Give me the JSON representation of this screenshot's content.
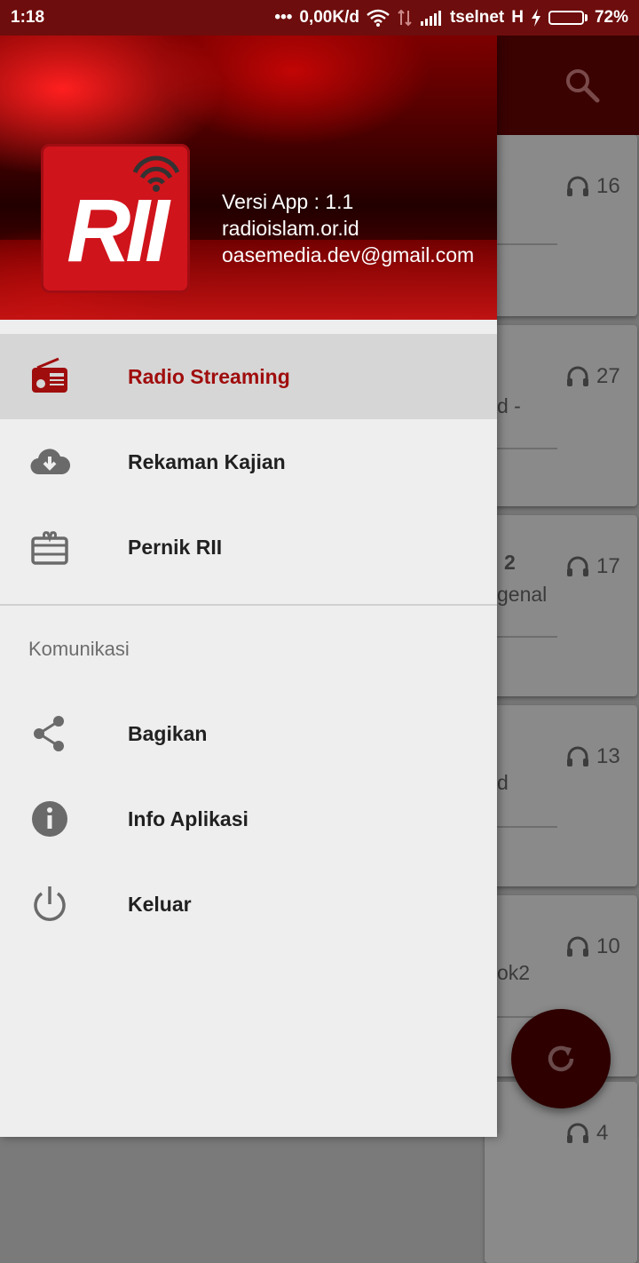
{
  "status_bar": {
    "time": "1:18",
    "speed": "0,00K/d",
    "carrier": "tselnet",
    "network": "H",
    "battery": "72%",
    "battery_level": 0.72
  },
  "background": {
    "cards": [
      {
        "count": "16",
        "text": ""
      },
      {
        "count": "27",
        "text": "d -"
      },
      {
        "count": "17",
        "text": "genal",
        "bold": "2"
      },
      {
        "count": "13",
        "text": "d"
      },
      {
        "count": "10",
        "text": "ok2"
      },
      {
        "count": "4",
        "text": ""
      }
    ]
  },
  "drawer": {
    "header": {
      "logo_text": "RII",
      "version": "Versi App : 1.1",
      "website": "radioislam.or.id",
      "email": "oasemedia.dev@gmail.com"
    },
    "items": [
      {
        "label": "Radio Streaming",
        "icon": "radio-icon"
      },
      {
        "label": "Rekaman Kajian",
        "icon": "cloud-download-icon"
      },
      {
        "label": "Pernik RII",
        "icon": "gift-card-icon"
      }
    ],
    "section": "Komunikasi",
    "comm_items": [
      {
        "label": "Bagikan",
        "icon": "share-icon"
      },
      {
        "label": "Info Aplikasi",
        "icon": "info-icon"
      },
      {
        "label": "Keluar",
        "icon": "power-icon"
      }
    ]
  },
  "colors": {
    "accent": "#a00d0d",
    "status_bar": "#6e0d0d",
    "toolbar_dimmed": "#3b0202"
  }
}
